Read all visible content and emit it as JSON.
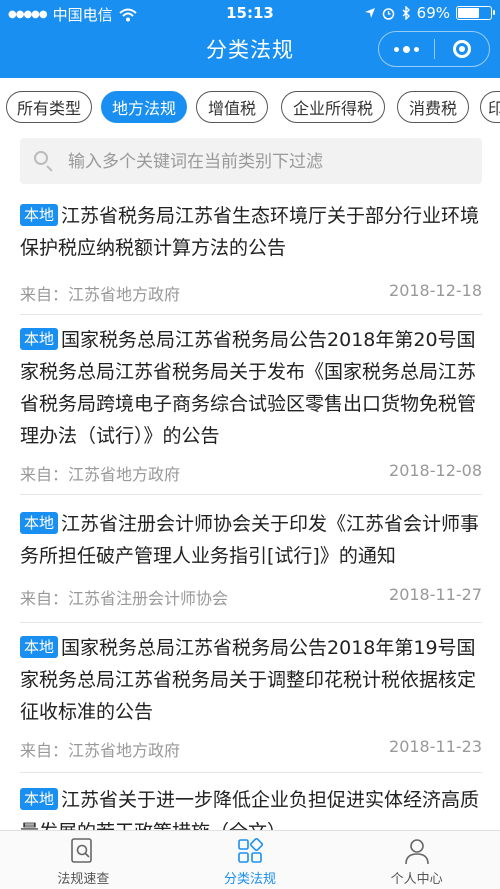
{
  "status_bar": {
    "carrier": "中国电信",
    "time": "15:13",
    "battery": "69%",
    "battery_level": 0.69
  },
  "navbar": {
    "title": "分类法规"
  },
  "colors": {
    "accent": "#1a8ff2",
    "meta_text": "#999999"
  },
  "tabs": [
    {
      "label": "所有类型",
      "active": false
    },
    {
      "label": "地方法规",
      "active": true
    },
    {
      "label": "增值税",
      "active": false
    },
    {
      "label": "企业所得税",
      "active": false
    },
    {
      "label": "消费税",
      "active": false
    },
    {
      "label": "印",
      "active": false
    }
  ],
  "search": {
    "placeholder": "输入多个关键词在当前类别下过滤",
    "value": ""
  },
  "items": [
    {
      "badge": "本地",
      "title": "江苏省税务局江苏省生态环境厅关于部分行业环境保护税应纳税额计算方法的公告",
      "source": "来自：江苏省地方政府",
      "date": "2018-12-18"
    },
    {
      "badge": "本地",
      "title": "国家税务总局江苏省税务局公告2018年第20号国家税务总局江苏省税务局关于发布《国家税务总局江苏省税务局跨境电子商务综合试验区零售出口货物免税管理办法（试行）》的公告",
      "source": "来自：江苏省地方政府",
      "date": "2018-12-08"
    },
    {
      "badge": "本地",
      "title": "江苏省注册会计师协会关于印发《江苏省会计师事务所担任破产管理人业务指引[试行]》的通知",
      "source": "来自：江苏省注册会计师协会",
      "date": "2018-11-27"
    },
    {
      "badge": "本地",
      "title": "国家税务总局江苏省税务局公告2018年第19号国家税务总局江苏省税务局关于调整印花税计税依据核定征收标准的公告",
      "source": "来自：江苏省地方政府",
      "date": "2018-11-23"
    },
    {
      "badge": "本地",
      "title": "江苏省关于进一步降低企业负担促进实体经济高质量发展的若干政策措施（全文）",
      "source": "",
      "date": ""
    }
  ],
  "bottom_nav": [
    {
      "label": "法规速查",
      "icon": "search-doc-icon",
      "active": false
    },
    {
      "label": "分类法规",
      "icon": "category-icon",
      "active": true
    },
    {
      "label": "个人中心",
      "icon": "person-icon",
      "active": false
    }
  ]
}
